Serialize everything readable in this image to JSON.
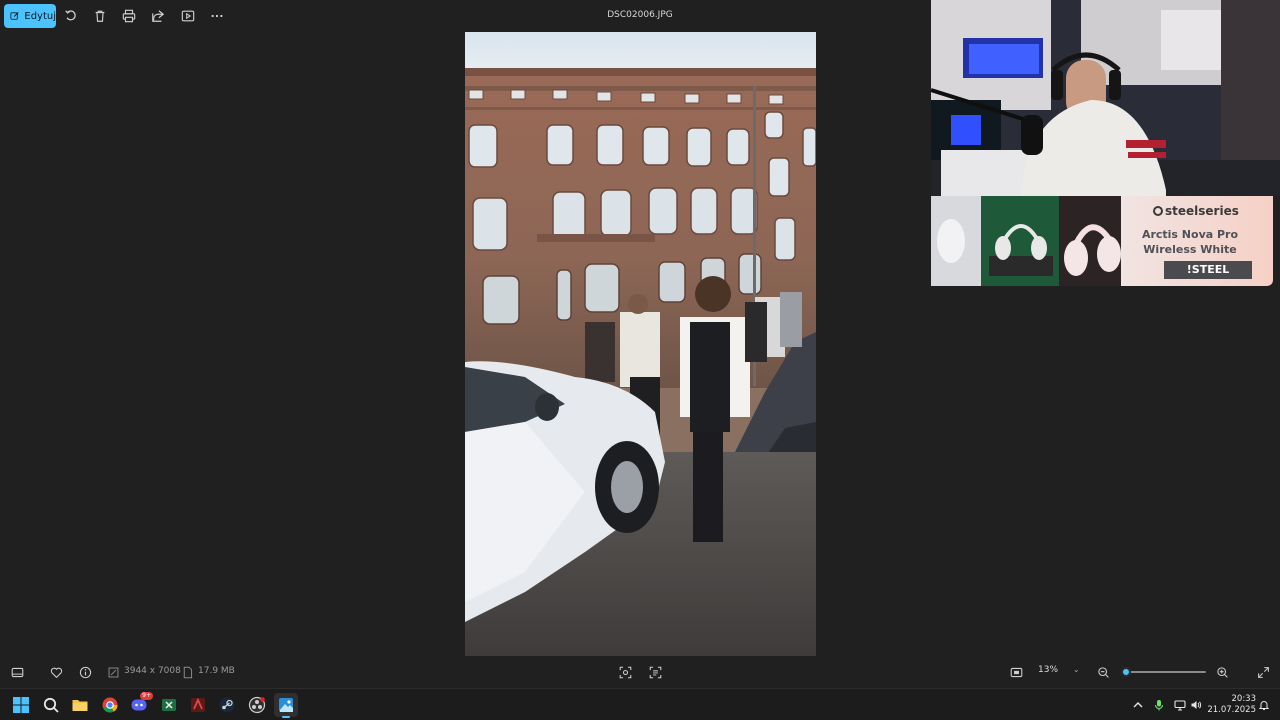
{
  "toolbar": {
    "edit_label": "Edytuj",
    "title": "DSC02006.JPG"
  },
  "status": {
    "dimensions": "3944 x 7008",
    "file_size": "17.9 MB",
    "zoom_value": "13%",
    "zoom_level": 0.0
  },
  "ad": {
    "brand": "steelseries",
    "product_line1": "Arctis Nova Pro",
    "product_line2": "Wireless White",
    "cta": "!STEEL"
  },
  "taskbar": {
    "discord_badge": "9+",
    "time": "20:33",
    "date": "21.07.2025"
  },
  "colors": {
    "accent": "#4cc2ff",
    "background": "#202020",
    "taskbar": "#1c1c1c"
  }
}
